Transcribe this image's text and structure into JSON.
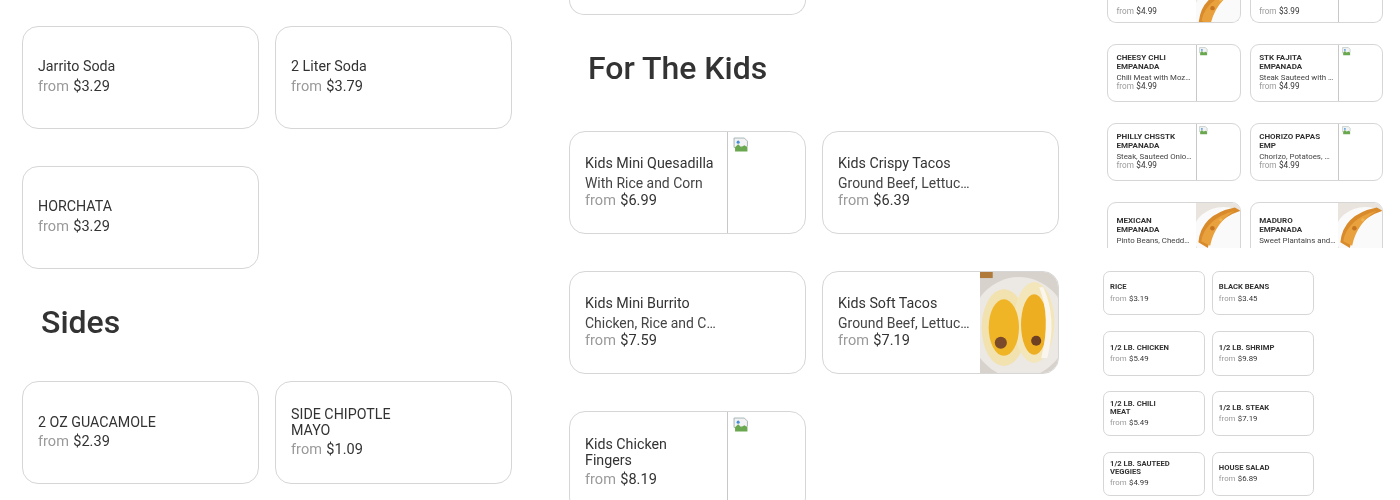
{
  "panels": [
    {
      "sections": [
        {
          "cards": [
            {
              "kind": "text",
              "title": "Jarrito Soda",
              "from": "from",
              "price": "$3.29"
            },
            {
              "kind": "text",
              "title": "2 Liter Soda",
              "from": "from",
              "price": "$3.79"
            },
            {
              "kind": "text",
              "title": "HORCHATA",
              "from": "from",
              "price": "$3.29"
            }
          ]
        },
        {
          "heading": "Sides",
          "cards": [
            {
              "kind": "text",
              "title": "2 OZ GUACAMOLE",
              "from": "from",
              "price": "$2.39"
            },
            {
              "kind": "text",
              "title": "SIDE CHIPOTLE MAYO",
              "from": "from",
              "price": "$1.09"
            }
          ]
        }
      ]
    },
    {
      "sections": [
        {
          "cards": [
            {
              "kind": "stub-blank"
            }
          ]
        },
        {
          "heading": "For The Kids",
          "cards": [
            {
              "kind": "broken-image",
              "title": "Kids Mini Quesadilla",
              "description": "With Rice and Corn",
              "from": "from",
              "price": "$6.99"
            },
            {
              "kind": "text",
              "title": "Kids Crispy Tacos",
              "description": "Ground Beef, Lettuc…",
              "from": "from",
              "price": "$6.39"
            },
            {
              "kind": "text",
              "title": "Kids Mini Burrito",
              "description": "Chicken, Rice and C…",
              "from": "from",
              "price": "$7.59"
            },
            {
              "title": "Kids Soft Tacos",
              "description": "Ground Beef, Lettuc…",
              "from": "from",
              "price": "$7.19"
            },
            {
              "kind": "broken-image",
              "title": "Kids Chicken Fingers",
              "from": "from",
              "price": "$8.19"
            }
          ]
        }
      ]
    },
    {
      "sections": [
        {
          "cards": [
            {
              "kind": "stub-photo",
              "from": "from",
              "price": "$4.99"
            },
            {
              "kind": "stub-broken",
              "from": "from",
              "price": "$3.99"
            },
            {
              "kind": "broken-image",
              "title": "CHEESY CHLI EMPANADA",
              "description": "Chili Meat with Moz…",
              "from": "from",
              "price": "$4.99"
            },
            {
              "kind": "broken-image",
              "title": "STK FAJITA EMPANADA",
              "description": "Steak Sauteed with …",
              "from": "from",
              "price": "$4.99"
            },
            {
              "kind": "broken-image",
              "title": "PHILLY CHSSTK EMPANADA",
              "description": "Steak, Sauteed Onio…",
              "from": "from",
              "price": "$4.99"
            },
            {
              "kind": "broken-image",
              "title": "CHORIZO PAPAS EMP",
              "description": "Chorizo, Potatoes, …",
              "from": "from",
              "price": "$4.99"
            },
            {
              "title": "MEXICAN EMPANADA",
              "description": "Pinto Beans, Chedd…"
            },
            {
              "title": "MADURO EMPANADA",
              "description": "Sweet Plantains and…"
            }
          ]
        }
      ]
    },
    {
      "sections": [
        {
          "cards": [
            {
              "kind": "text",
              "title": "RICE",
              "from": "from",
              "price": "$3.19"
            },
            {
              "kind": "text",
              "title": "BLACK BEANS",
              "from": "from",
              "price": "$3.45"
            },
            {
              "kind": "text",
              "title": "1/2 LB. CHICKEN",
              "from": "from",
              "price": "$5.49"
            },
            {
              "kind": "text",
              "title": "1/2 LB. SHRIMP",
              "from": "from",
              "price": "$9.89"
            },
            {
              "kind": "text",
              "title": "1/2 LB. CHILI MEAT",
              "from": "from",
              "price": "$5.49"
            },
            {
              "kind": "text",
              "title": "1/2 LB. STEAK",
              "from": "from",
              "price": "$7.19"
            },
            {
              "kind": "text",
              "title": "1/2 LB. SAUTEED VEGGIES",
              "from": "from",
              "price": "$4.99"
            },
            {
              "kind": "text",
              "title": "HOUSE SALAD",
              "from": "from",
              "price": "$6.89"
            }
          ]
        }
      ]
    }
  ]
}
